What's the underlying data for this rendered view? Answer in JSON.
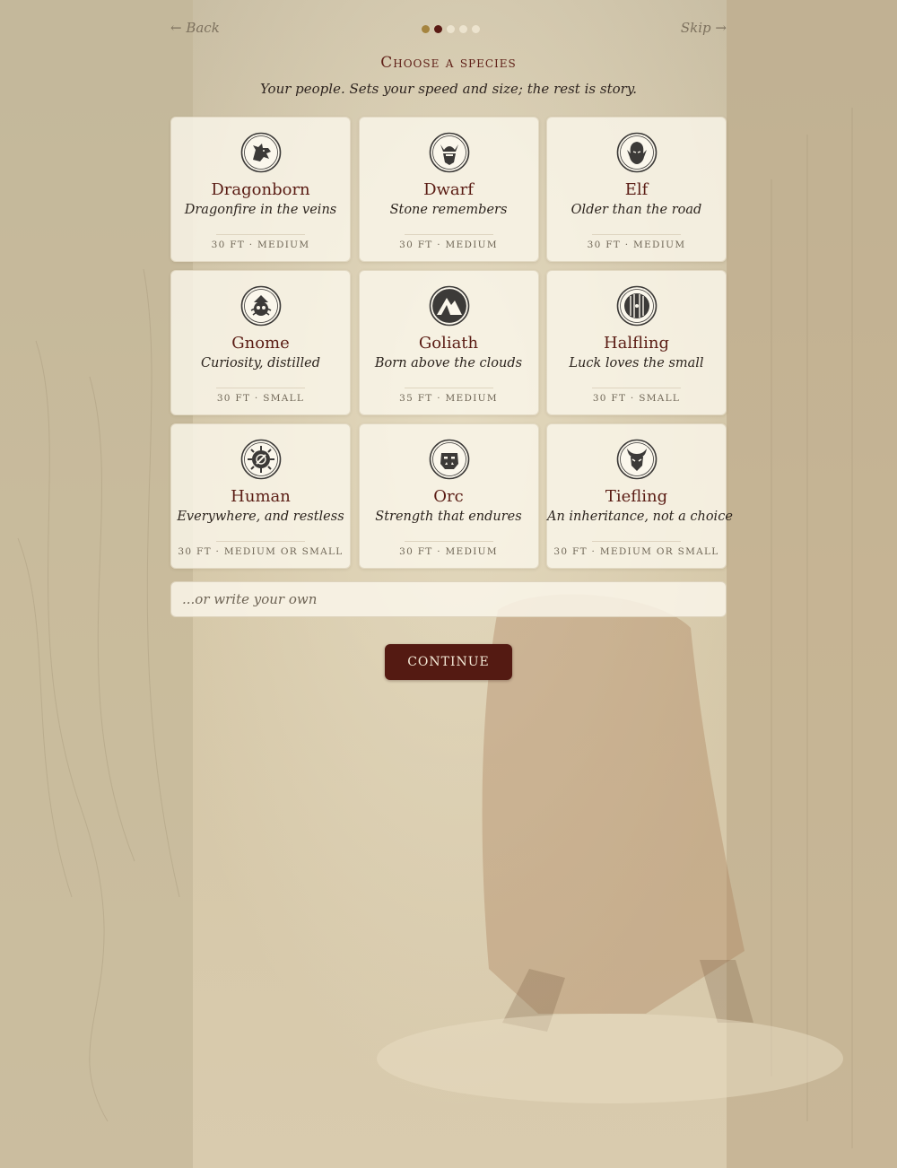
{
  "nav": {
    "back_label": "← Back",
    "skip_label": "Skip →",
    "steps": [
      "done",
      "active",
      "pending",
      "pending",
      "pending"
    ]
  },
  "header": {
    "title": "Choose a species",
    "subtitle": "Your people. Sets your speed and size; the rest is story."
  },
  "species": [
    {
      "name": "Dragonborn",
      "tagline": "Dragonfire in the veins",
      "stats": "30 ft · Medium",
      "icon": "dragon-head-icon"
    },
    {
      "name": "Dwarf",
      "tagline": "Stone remembers",
      "stats": "30 ft · Medium",
      "icon": "horned-helm-dwarf-icon"
    },
    {
      "name": "Elf",
      "tagline": "Older than the road",
      "stats": "30 ft · Medium",
      "icon": "elf-face-icon"
    },
    {
      "name": "Gnome",
      "tagline": "Curiosity, distilled",
      "stats": "30 ft · Small",
      "icon": "gnome-tinker-icon"
    },
    {
      "name": "Goliath",
      "tagline": "Born above the clouds",
      "stats": "35 ft · Medium",
      "icon": "mountain-peak-icon"
    },
    {
      "name": "Halfling",
      "tagline": "Luck loves the small",
      "stats": "30 ft · Small",
      "icon": "round-door-icon"
    },
    {
      "name": "Human",
      "tagline": "Everywhere, and restless",
      "stats": "30 ft · Medium or Small",
      "icon": "compass-sun-icon"
    },
    {
      "name": "Orc",
      "tagline": "Strength that endures",
      "stats": "30 ft · Medium",
      "icon": "orc-face-icon"
    },
    {
      "name": "Tiefling",
      "tagline": "An inheritance, not a choice",
      "stats": "30 ft · Medium or Small",
      "icon": "horned-devil-icon"
    }
  ],
  "custom": {
    "placeholder": "...or write your own"
  },
  "actions": {
    "continue_label": "CONTINUE"
  },
  "colors": {
    "accent": "#541a12",
    "title": "#5e1e16",
    "card_bg": "#faf6ea",
    "step_done": "#a5843f"
  }
}
